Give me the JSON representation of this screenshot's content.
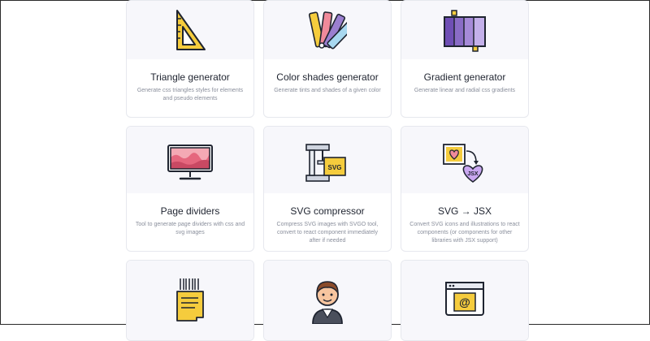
{
  "cards": [
    {
      "title": "Triangle generator",
      "description": "Generate css triangles styles for elements and pseudo elements",
      "icon": "set-square-ruler-icon"
    },
    {
      "title": "Color shades generator",
      "description": "Generate tints and shades of a given color",
      "icon": "color-swatch-fan-icon"
    },
    {
      "title": "Gradient generator",
      "description": "Generate linear and radial css gradients",
      "icon": "gradient-palette-icon"
    },
    {
      "title": "Page dividers",
      "description": "Tool to generate page dividers with css and svg images",
      "icon": "monitor-wave-icon"
    },
    {
      "title": "SVG compressor",
      "description": "Compress SVG images with SVGO tool, convert to react component immediately after if needed",
      "icon": "svg-clamp-icon",
      "badge": "SVG"
    },
    {
      "title": "SVG → JSX",
      "description": "Convert SVG icons and illustrations to react components (or components for other libraries with JSX support)",
      "icon": "svg-to-jsx-icon",
      "badge": "JSX"
    },
    {
      "title": "",
      "description": "",
      "icon": "barcode-document-icon"
    },
    {
      "title": "",
      "description": "",
      "icon": "avatar-person-icon"
    },
    {
      "title": "",
      "description": "",
      "icon": "email-at-browser-icon",
      "badge": "@"
    }
  ],
  "colors": {
    "card_top": "#f7f7fb",
    "card_border": "#e6e8ee",
    "title": "#1f2430",
    "description": "#8a8f9c",
    "accent_yellow": "#f5cc3d",
    "accent_purple": "#9b7fd0",
    "accent_pink": "#f08a9a"
  }
}
